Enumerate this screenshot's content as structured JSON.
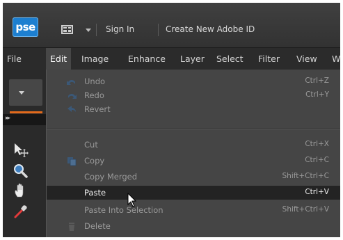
{
  "app": {
    "logo_text": "pse"
  },
  "topbar": {
    "sign_in": "Sign In",
    "create_id": "Create New Adobe ID"
  },
  "menubar": {
    "items": [
      "File",
      "Edit",
      "Image",
      "Enhance",
      "Layer",
      "Select",
      "Filter",
      "View",
      "W"
    ],
    "active": "Edit"
  },
  "edit_menu": {
    "items": [
      {
        "label": "Undo",
        "shortcut": "Ctrl+Z",
        "icon": "undo-icon",
        "enabled": false
      },
      {
        "label": "Redo",
        "shortcut": "Ctrl+Y",
        "icon": "redo-icon",
        "enabled": false
      },
      {
        "label": "Revert",
        "shortcut": "",
        "icon": "revert-icon",
        "enabled": false
      },
      {
        "label": "Cut",
        "shortcut": "Ctrl+X",
        "icon": "",
        "enabled": false
      },
      {
        "label": "Copy",
        "shortcut": "Ctrl+C",
        "icon": "copy-icon",
        "enabled": false
      },
      {
        "label": "Copy Merged",
        "shortcut": "Shift+Ctrl+C",
        "icon": "",
        "enabled": false
      },
      {
        "label": "Paste",
        "shortcut": "Ctrl+V",
        "icon": "",
        "enabled": true,
        "highlighted": true
      },
      {
        "label": "Paste Into Selection",
        "shortcut": "Shift+Ctrl+V",
        "icon": "",
        "enabled": false
      },
      {
        "label": "Delete",
        "shortcut": "",
        "icon": "trash-icon",
        "enabled": false
      }
    ]
  },
  "tools": [
    "move-tool-icon",
    "zoom-tool-icon",
    "hand-tool-icon",
    "eyedropper-tool-icon"
  ],
  "colors": {
    "accent": "#e26a1c",
    "logo": "#1d7fd0",
    "menu_bg": "#454545",
    "highlight": "#232323"
  }
}
